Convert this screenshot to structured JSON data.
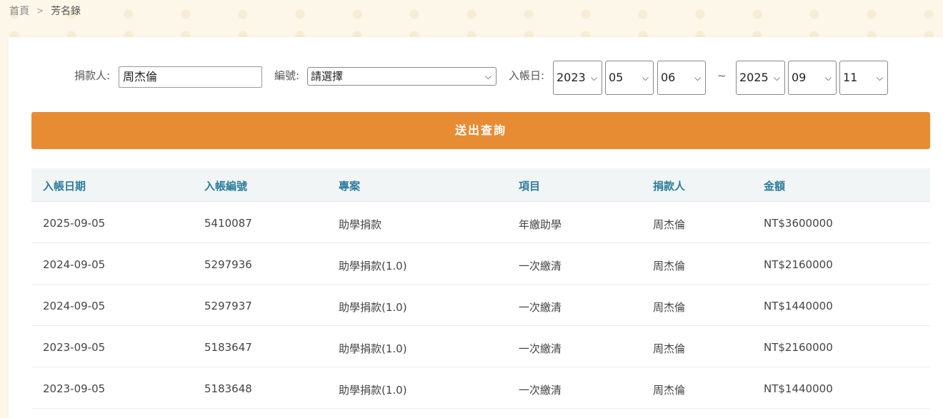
{
  "breadcrumb": {
    "home": "首頁",
    "separator": ">",
    "current": "芳名錄"
  },
  "filters": {
    "donor_label": "捐款人:",
    "donor_value": "周杰倫",
    "number_label": "編號:",
    "number_selected": "請選擇",
    "date_label": "入帳日:",
    "from": {
      "year": "2023",
      "month": "05",
      "day": "06"
    },
    "range_sep": "~",
    "to": {
      "year": "2025",
      "month": "09",
      "day": "11"
    }
  },
  "submit_label": "送出查詢",
  "table": {
    "columns": [
      "入帳日期",
      "入帳編號",
      "專案",
      "項目",
      "捐款人",
      "金額"
    ],
    "rows": [
      [
        "2025-09-05",
        "5410087",
        "助學捐款",
        "年繳助學",
        "周杰倫",
        "NT$3600000"
      ],
      [
        "2024-09-05",
        "5297936",
        "助學捐款(1.0)",
        "一次繳清",
        "周杰倫",
        "NT$2160000"
      ],
      [
        "2024-09-05",
        "5297937",
        "助學捐款(1.0)",
        "一次繳清",
        "周杰倫",
        "NT$1440000"
      ],
      [
        "2023-09-05",
        "5183647",
        "助學捐款(1.0)",
        "一次繳清",
        "周杰倫",
        "NT$2160000"
      ],
      [
        "2023-09-05",
        "5183648",
        "助學捐款(1.0)",
        "一次繳清",
        "周杰倫",
        "NT$1440000"
      ]
    ]
  },
  "colors": {
    "accent": "#e88c34",
    "header_text": "#2d7c9c",
    "page_bg": "#fdf7ea"
  }
}
